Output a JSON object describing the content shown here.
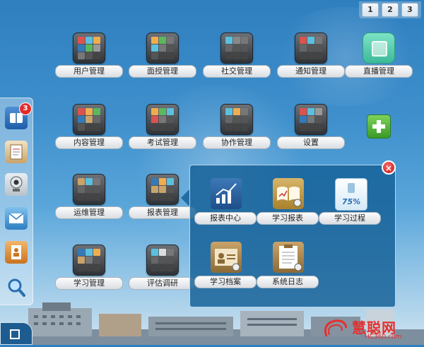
{
  "pager": {
    "pages": [
      "1",
      "2",
      "3"
    ]
  },
  "dock": {
    "items": [
      {
        "name": "library-icon",
        "badge": "3"
      },
      {
        "name": "notebook-icon"
      },
      {
        "name": "webcam-icon"
      },
      {
        "name": "mail-icon"
      },
      {
        "name": "contacts-icon"
      },
      {
        "name": "magnifier-icon"
      }
    ]
  },
  "apps": [
    {
      "label": "用户管理"
    },
    {
      "label": "面授管理"
    },
    {
      "label": "社交管理"
    },
    {
      "label": "通知管理"
    },
    {
      "label": "直播管理"
    },
    {
      "label": "内容管理"
    },
    {
      "label": "考试管理"
    },
    {
      "label": "协作管理"
    },
    {
      "label": "设置"
    },
    {
      "label": "运维管理"
    },
    {
      "label": "报表管理"
    },
    {
      "label": "学习管理"
    },
    {
      "label": "评估调研"
    }
  ],
  "popup": {
    "close": "×",
    "items": [
      {
        "label": "报表中心",
        "icon": "chart-growth-icon"
      },
      {
        "label": "学习报表",
        "icon": "open-book-icon"
      },
      {
        "label": "学习过程",
        "icon": "progress-icon",
        "progress": "75%"
      },
      {
        "label": "学习档案",
        "icon": "profile-card-icon"
      },
      {
        "label": "系统日志",
        "icon": "clipboard-log-icon"
      }
    ]
  },
  "watermark": {
    "title": "慧聪网",
    "url": "HC360.com"
  },
  "colors": {
    "accent": "#2f7fbf",
    "badge": "#e32b2b",
    "add": "#3a9a26",
    "panel": "#145f96"
  }
}
